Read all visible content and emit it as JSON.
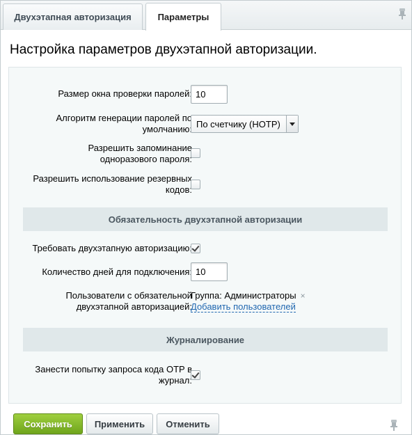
{
  "tabs": [
    {
      "label": "Двухэтапная авторизация",
      "active": false
    },
    {
      "label": "Параметры",
      "active": true
    }
  ],
  "page_title": "Настройка параметров двухэтапной авторизации.",
  "settings": {
    "window_size": {
      "label": "Размер окна проверки паролей:",
      "value": "10"
    },
    "algorithm": {
      "label_line1": "Алгоритм генерации паролей по",
      "label_line2": "умолчанию:",
      "value": "По счетчику (HOTP)"
    },
    "remember_otp": {
      "label_line1": "Разрешить запоминание",
      "label_line2": "одноразового пароля:",
      "checked": false
    },
    "backup_codes": {
      "label_line1": "Разрешить использование резервных",
      "label_line2": "кодов:",
      "checked": false
    }
  },
  "mandatory_section": {
    "title": "Обязательность двухэтапной авторизации",
    "require": {
      "label": "Требовать двухэтапную авторизацию:",
      "checked": true
    },
    "days": {
      "label": "Количество дней для подключения:",
      "value": "10"
    },
    "users": {
      "label_line1": "Пользователи с обязательной",
      "label_line2": "двухэтапной авторизацией:",
      "group": "Группа: Администраторы",
      "remove_symbol": "×",
      "add_link": "Добавить пользователей"
    }
  },
  "logging_section": {
    "title": "Журналирование",
    "log_otp": {
      "label_line1": "Занести попытку запроса кода OTP в",
      "label_line2": "журнал:",
      "checked": true
    }
  },
  "buttons": {
    "save": "Сохранить",
    "apply": "Применить",
    "cancel": "Отменить"
  },
  "colors": {
    "accent_green": "#6fa51c",
    "link_blue": "#2067b0",
    "section_bg": "#e0e8ea"
  },
  "icons": [
    "pin-icon",
    "dropdown-arrow-icon",
    "checkmark-icon",
    "remove-icon"
  ]
}
